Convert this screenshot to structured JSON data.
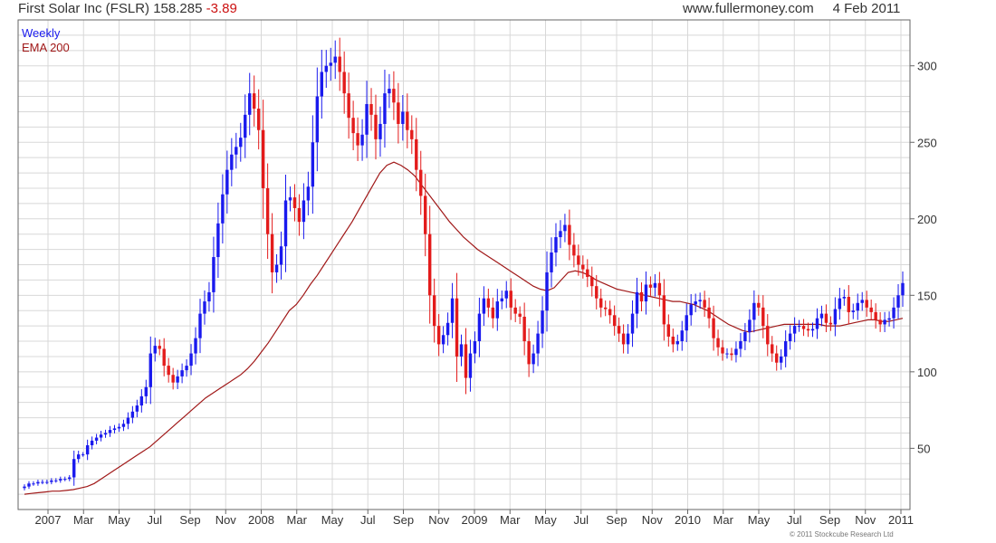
{
  "header": {
    "title": "First Solar Inc (FSLR)",
    "price": "158.285",
    "change": "-3.89",
    "website": "www.fullermoney.com",
    "date": "4 Feb 2011"
  },
  "copyright": "© 2011 Stockcube Research Ltd",
  "colors": {
    "up": "#1a1aee",
    "down": "#e31b1b",
    "ema": "#a01818",
    "grid": "#d8d8d8",
    "neg_text": "#cc1111"
  },
  "chart_data": {
    "type": "candlestick",
    "legend": [
      "Weekly",
      "EMA 200"
    ],
    "legend_placement": "top-left",
    "ylim": [
      10,
      330
    ],
    "y_ticks": [
      50,
      100,
      150,
      200,
      250,
      300
    ],
    "x_tick_labels": [
      "2007",
      "Mar",
      "May",
      "Jul",
      "Sep",
      "Nov",
      "2008",
      "Mar",
      "May",
      "Jul",
      "Sep",
      "Nov",
      "2009",
      "Mar",
      "May",
      "Jul",
      "Sep",
      "Nov",
      "2010",
      "Mar",
      "May",
      "Jul",
      "Sep",
      "Nov",
      "2011"
    ],
    "grid": true,
    "weekly_closes": [
      25,
      27,
      27,
      28,
      28,
      28,
      29,
      29,
      30,
      30,
      31,
      43,
      46,
      46,
      52,
      55,
      57,
      59,
      60,
      62,
      63,
      64,
      66,
      70,
      74,
      78,
      84,
      90,
      112,
      117,
      115,
      104,
      98,
      93,
      97,
      101,
      104,
      112,
      122,
      138,
      146,
      152,
      175,
      197,
      216,
      232,
      242,
      247,
      253,
      268,
      282,
      272,
      258,
      220,
      190,
      165,
      170,
      182,
      212,
      214,
      207,
      198,
      212,
      221,
      250,
      280,
      296,
      300,
      302,
      306,
      296,
      282,
      266,
      256,
      248,
      255,
      275,
      268,
      252,
      262,
      282,
      285,
      276,
      262,
      270,
      258,
      252,
      232,
      215,
      190,
      150,
      130,
      118,
      124,
      132,
      148,
      110,
      118,
      96,
      112,
      120,
      138,
      148,
      142,
      135,
      146,
      148,
      153,
      142,
      138,
      136,
      120,
      105,
      112,
      125,
      140,
      165,
      178,
      188,
      192,
      196,
      183,
      176,
      170,
      167,
      162,
      156,
      148,
      142,
      141,
      137,
      130,
      125,
      118,
      125,
      138,
      152,
      146,
      157,
      155,
      158,
      150,
      131,
      123,
      118,
      120,
      127,
      137,
      144,
      146,
      147,
      142,
      135,
      122,
      116,
      112,
      112,
      111,
      115,
      120,
      126,
      134,
      145,
      142,
      130,
      118,
      112,
      106,
      110,
      120,
      125,
      130,
      130,
      128,
      127,
      128,
      135,
      138,
      132,
      131,
      141,
      148,
      149,
      139,
      140,
      145,
      147,
      142,
      139,
      134,
      131,
      134,
      135,
      142,
      150,
      158
    ],
    "ema_200": [
      20,
      20.5,
      21,
      21.5,
      22,
      22,
      22.5,
      23,
      24,
      25,
      27,
      30,
      33,
      36,
      39,
      42,
      45,
      48,
      51,
      55,
      59,
      63,
      67,
      71,
      75,
      79,
      83,
      86,
      89,
      92,
      95,
      98,
      102,
      107,
      113,
      119,
      126,
      133,
      140,
      144,
      150,
      157,
      163,
      170,
      177,
      184,
      191,
      198,
      206,
      214,
      222,
      230,
      235,
      237,
      235,
      232,
      228,
      222,
      216,
      210,
      204,
      198,
      193,
      188,
      184,
      180,
      177,
      174,
      171,
      168,
      165,
      162,
      159,
      156,
      154,
      153,
      155,
      160,
      165,
      166,
      165,
      163,
      160,
      158,
      156,
      154,
      153,
      152,
      151,
      150,
      149,
      148,
      147,
      146,
      146,
      145,
      144,
      142,
      140,
      137,
      134,
      131,
      129,
      127,
      126,
      127,
      128,
      129,
      130,
      131,
      131,
      131,
      131,
      131,
      131,
      130,
      130,
      130,
      131,
      132,
      133,
      134,
      134,
      133,
      133,
      134,
      135
    ]
  }
}
